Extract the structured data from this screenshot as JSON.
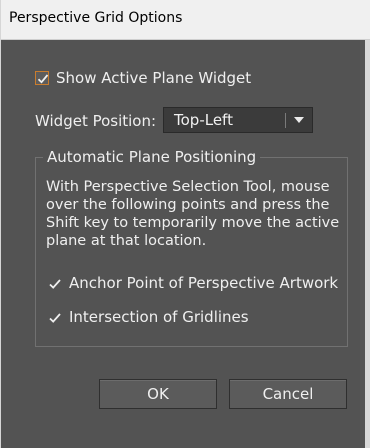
{
  "window": {
    "title": "Perspective Grid Options"
  },
  "show_widget": {
    "label": "Show Active Plane Widget",
    "checked": true
  },
  "widget_position": {
    "label": "Widget Position:",
    "value": "Top-Left"
  },
  "auto_positioning": {
    "legend": "Automatic Plane Positioning",
    "description": "With Perspective Selection Tool, mouse over the following points and press the Shift key to temporarily move the active plane at that location.",
    "anchor_point": {
      "label": "Anchor Point of Perspective Artwork",
      "checked": true
    },
    "intersection": {
      "label": "Intersection of Gridlines",
      "checked": true
    }
  },
  "buttons": {
    "ok": "OK",
    "cancel": "Cancel"
  },
  "colors": {
    "dialog_bg": "#535353",
    "accent_checkbox": "#c97c2d"
  }
}
